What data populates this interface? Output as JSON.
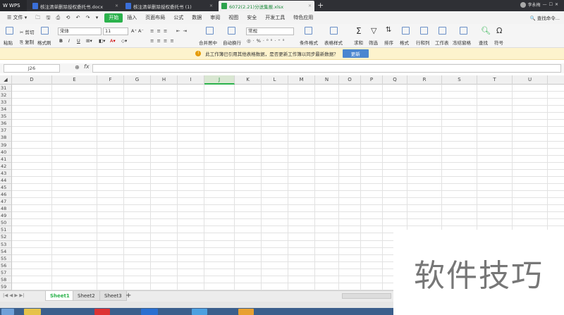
{
  "titlebar": {
    "app": "WPS",
    "tabs": [
      {
        "label": "核注清单删除授权委托书.docx",
        "type": "doc"
      },
      {
        "label": "核注清单删除授权委托书 (1)",
        "type": "doc"
      },
      {
        "label": "6072(2.21)分送集报.xlsx",
        "type": "xls"
      }
    ],
    "new_tab": "+",
    "user_name": "李永梅"
  },
  "menu": {
    "file": "文件",
    "items": [
      "开始",
      "插入",
      "页面布局",
      "公式",
      "数据",
      "审阅",
      "视图",
      "安全",
      "开发工具",
      "特色应用"
    ],
    "search": "查找命令..."
  },
  "toolbar": {
    "paste": "粘贴",
    "cut": "剪切",
    "copy": "复制",
    "format_painter": "格式刷",
    "font": "宋体",
    "font_size": "11",
    "merge": "合并居中",
    "wrap": "自动换行",
    "number_format": "常规",
    "cond_format": "条件格式",
    "table_style": "表格样式",
    "sum": "求和",
    "filter": "筛选",
    "sort": "排序",
    "format": "格式",
    "rowcol": "行和列",
    "worksheet": "工作表",
    "freeze": "冻结窗格",
    "find": "查找",
    "symbol": "符号"
  },
  "infobar": {
    "message": "此工作簿已引用其他表格数据，是否更新工作簿以同步最新数据？",
    "button": "更新"
  },
  "formula": {
    "name_box": "J26",
    "fx": "fx",
    "value": ""
  },
  "columns": [
    "D",
    "E",
    "F",
    "G",
    "H",
    "I",
    "J",
    "K",
    "L",
    "M",
    "N",
    "O",
    "P",
    "Q",
    "R",
    "S",
    "T",
    "U"
  ],
  "selected_column": "J",
  "rows": [
    "31",
    "32",
    "33",
    "34",
    "35",
    "36",
    "37",
    "38",
    "39",
    "40",
    "41",
    "42",
    "43",
    "44",
    "45",
    "46",
    "47",
    "48",
    "49",
    "50",
    "51",
    "52",
    "53",
    "54",
    "55",
    "56",
    "57",
    "58",
    "59"
  ],
  "sheets": [
    "Sheet1",
    "Sheet2",
    "Sheet3"
  ],
  "active_sheet": "Sheet1",
  "add_sheet": "+",
  "watermark": "软件技巧",
  "colors": {
    "accent": "#2bb24c",
    "titlebar": "#2f3035",
    "infobar": "#fdf3cd"
  }
}
